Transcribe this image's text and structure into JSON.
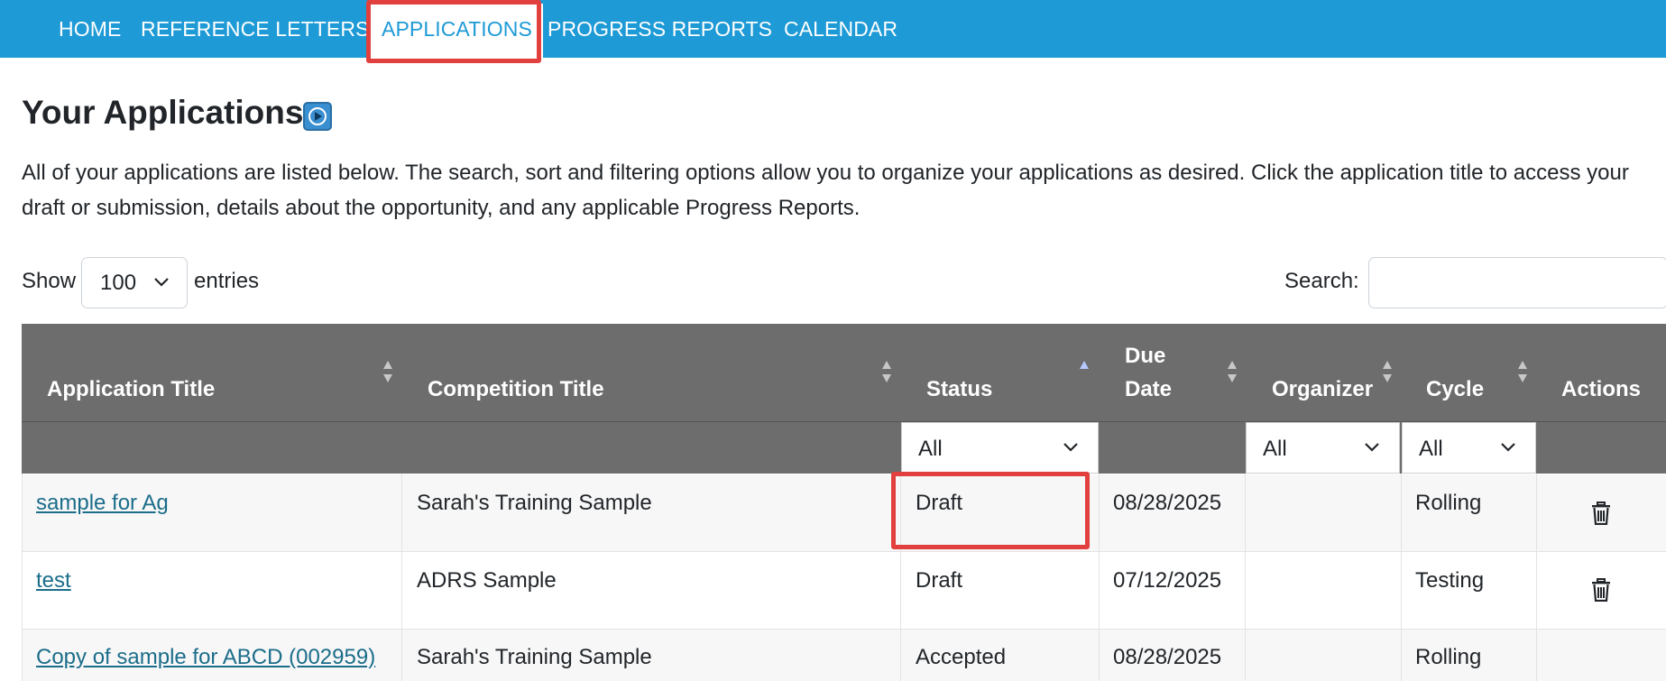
{
  "nav": {
    "items": [
      {
        "label": "HOME",
        "active": false
      },
      {
        "label": "REFERENCE LETTERS",
        "active": false
      },
      {
        "label": "APPLICATIONS",
        "active": true
      },
      {
        "label": "PROGRESS REPORTS",
        "active": false
      },
      {
        "label": "CALENDAR",
        "active": false
      }
    ]
  },
  "page": {
    "title": "Your Applications",
    "intro": "All of your applications are listed below. The search, sort and filtering options allow you to organize your applications as desired. Click the application title to access your draft or submission, details about the opportunity, and any applicable Progress Reports."
  },
  "controls": {
    "show_label": "Show",
    "entries_value": "100",
    "entries_label": "entries",
    "search_label": "Search:",
    "search_value": ""
  },
  "table": {
    "headers": {
      "application_title": "Application Title",
      "competition_title": "Competition Title",
      "status": "Status",
      "due_date_line1": "Due",
      "due_date_line2": "Date",
      "organizer": "Organizer",
      "cycle": "Cycle",
      "actions": "Actions"
    },
    "filters": {
      "status": "All",
      "organizer": "All",
      "cycle": "All"
    },
    "rows": [
      {
        "application_title": "sample for Ag",
        "competition_title": "Sarah's Training Sample",
        "status": "Draft",
        "due_date": "08/28/2025",
        "organizer": "",
        "cycle": "Rolling"
      },
      {
        "application_title": "test",
        "competition_title": "ADRS Sample",
        "status": "Draft",
        "due_date": "07/12/2025",
        "organizer": "",
        "cycle": "Testing"
      },
      {
        "application_title": "Copy of sample for ABCD (002959)",
        "competition_title": "Sarah's Training Sample",
        "status": "Accepted",
        "due_date": "08/28/2025",
        "organizer": "",
        "cycle": "Rolling"
      }
    ]
  },
  "colors": {
    "navbar": "#1e9ad6",
    "highlight": "#e2403f",
    "table_header": "#6d6d6d",
    "link": "#1b6d8a"
  },
  "icons": {
    "video": "play-circle-icon",
    "sort": "sort-arrows-icon",
    "delete": "trash-icon",
    "dropdown": "chevron-down-icon"
  }
}
